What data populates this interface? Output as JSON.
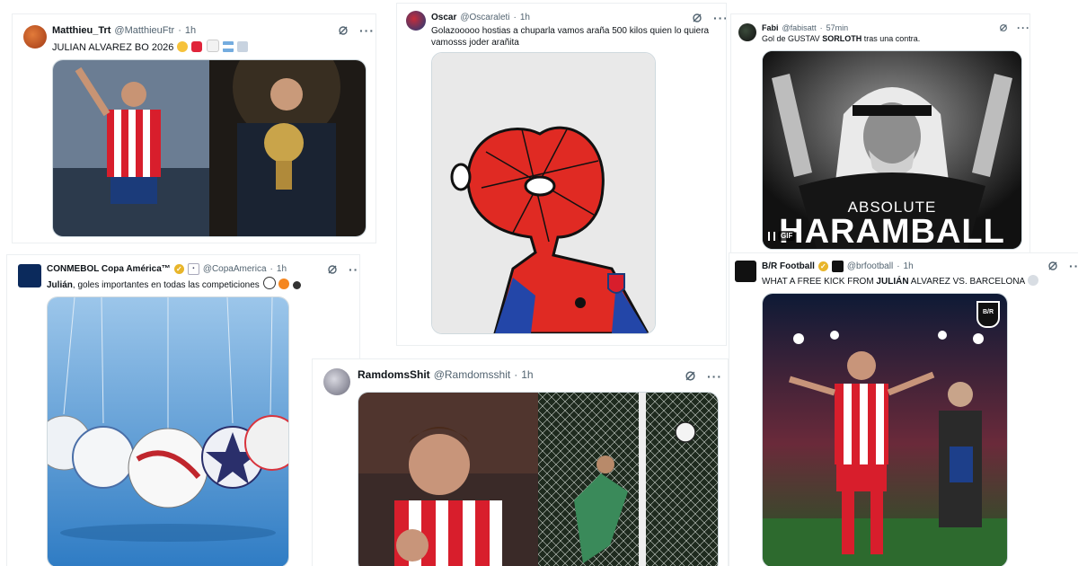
{
  "posts": [
    {
      "name": "Matthieu_Trt",
      "handle": "@MatthieuFtr",
      "time": "1h",
      "text": "JULIAN ALVAREZ BO 2026"
    },
    {
      "name": "Oscar",
      "handle": "@Oscaraleti",
      "time": "1h",
      "text_line1": "Golazooooo hostias a chuparla vamos araña 500 kilos quien lo quiera",
      "text_line2": "vamosss joder arañita"
    },
    {
      "name": "Fabi",
      "handle": "@fabisatt",
      "time": "57min",
      "text_pre": "Gol de GUSTAV ",
      "text_bold": "SORLOTH",
      "text_post": " tras una contra.",
      "img_caption_small": "ABSOLUTE",
      "img_caption_big": "HARAMBALL",
      "img_gif": "GIF"
    },
    {
      "name": "CONMEBOL Copa América™",
      "handle": "@CopaAmerica",
      "time": "1h",
      "text_bold": "Julián",
      "text_post": ", goles importantes en todas las competiciones"
    },
    {
      "name": "RamdomsShit",
      "handle": "@Ramdomsshit",
      "time": "1h"
    },
    {
      "name": "B/R Football",
      "handle": "@brfootball",
      "time": "1h",
      "text_pre": "WHAT A FREE KICK FROM ",
      "text_bold": "JULIÁN",
      "text_post": " ALVAREZ VS. BARCELONA",
      "logo_text": "B/R"
    }
  ],
  "separator": "·",
  "more_label": "···",
  "colors": {
    "atleti_red": "#d81e2c",
    "atleti_blue": "#1b3b7a",
    "spiderman_red": "#e02a23",
    "pitch_green": "#2d6a2e",
    "sky": "#5aa0d8"
  }
}
